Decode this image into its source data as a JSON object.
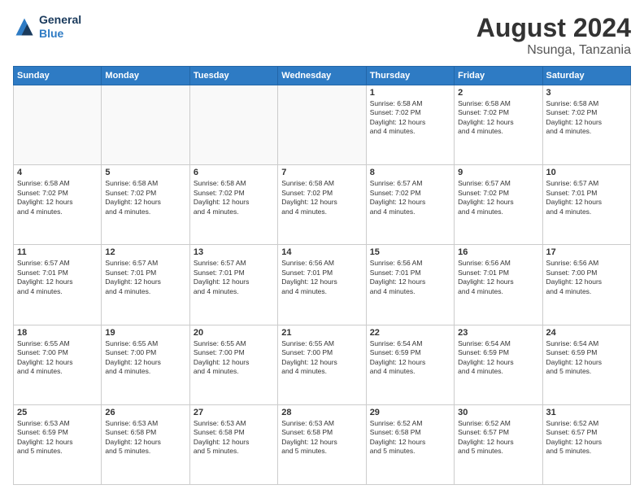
{
  "header": {
    "logo_line1": "General",
    "logo_line2": "Blue",
    "month": "August 2024",
    "location": "Nsunga, Tanzania"
  },
  "days_of_week": [
    "Sunday",
    "Monday",
    "Tuesday",
    "Wednesday",
    "Thursday",
    "Friday",
    "Saturday"
  ],
  "weeks": [
    [
      {
        "num": "",
        "info": ""
      },
      {
        "num": "",
        "info": ""
      },
      {
        "num": "",
        "info": ""
      },
      {
        "num": "",
        "info": ""
      },
      {
        "num": "1",
        "info": "Sunrise: 6:58 AM\nSunset: 7:02 PM\nDaylight: 12 hours\nand 4 minutes."
      },
      {
        "num": "2",
        "info": "Sunrise: 6:58 AM\nSunset: 7:02 PM\nDaylight: 12 hours\nand 4 minutes."
      },
      {
        "num": "3",
        "info": "Sunrise: 6:58 AM\nSunset: 7:02 PM\nDaylight: 12 hours\nand 4 minutes."
      }
    ],
    [
      {
        "num": "4",
        "info": "Sunrise: 6:58 AM\nSunset: 7:02 PM\nDaylight: 12 hours\nand 4 minutes."
      },
      {
        "num": "5",
        "info": "Sunrise: 6:58 AM\nSunset: 7:02 PM\nDaylight: 12 hours\nand 4 minutes."
      },
      {
        "num": "6",
        "info": "Sunrise: 6:58 AM\nSunset: 7:02 PM\nDaylight: 12 hours\nand 4 minutes."
      },
      {
        "num": "7",
        "info": "Sunrise: 6:58 AM\nSunset: 7:02 PM\nDaylight: 12 hours\nand 4 minutes."
      },
      {
        "num": "8",
        "info": "Sunrise: 6:57 AM\nSunset: 7:02 PM\nDaylight: 12 hours\nand 4 minutes."
      },
      {
        "num": "9",
        "info": "Sunrise: 6:57 AM\nSunset: 7:02 PM\nDaylight: 12 hours\nand 4 minutes."
      },
      {
        "num": "10",
        "info": "Sunrise: 6:57 AM\nSunset: 7:01 PM\nDaylight: 12 hours\nand 4 minutes."
      }
    ],
    [
      {
        "num": "11",
        "info": "Sunrise: 6:57 AM\nSunset: 7:01 PM\nDaylight: 12 hours\nand 4 minutes."
      },
      {
        "num": "12",
        "info": "Sunrise: 6:57 AM\nSunset: 7:01 PM\nDaylight: 12 hours\nand 4 minutes."
      },
      {
        "num": "13",
        "info": "Sunrise: 6:57 AM\nSunset: 7:01 PM\nDaylight: 12 hours\nand 4 minutes."
      },
      {
        "num": "14",
        "info": "Sunrise: 6:56 AM\nSunset: 7:01 PM\nDaylight: 12 hours\nand 4 minutes."
      },
      {
        "num": "15",
        "info": "Sunrise: 6:56 AM\nSunset: 7:01 PM\nDaylight: 12 hours\nand 4 minutes."
      },
      {
        "num": "16",
        "info": "Sunrise: 6:56 AM\nSunset: 7:01 PM\nDaylight: 12 hours\nand 4 minutes."
      },
      {
        "num": "17",
        "info": "Sunrise: 6:56 AM\nSunset: 7:00 PM\nDaylight: 12 hours\nand 4 minutes."
      }
    ],
    [
      {
        "num": "18",
        "info": "Sunrise: 6:55 AM\nSunset: 7:00 PM\nDaylight: 12 hours\nand 4 minutes."
      },
      {
        "num": "19",
        "info": "Sunrise: 6:55 AM\nSunset: 7:00 PM\nDaylight: 12 hours\nand 4 minutes."
      },
      {
        "num": "20",
        "info": "Sunrise: 6:55 AM\nSunset: 7:00 PM\nDaylight: 12 hours\nand 4 minutes."
      },
      {
        "num": "21",
        "info": "Sunrise: 6:55 AM\nSunset: 7:00 PM\nDaylight: 12 hours\nand 4 minutes."
      },
      {
        "num": "22",
        "info": "Sunrise: 6:54 AM\nSunset: 6:59 PM\nDaylight: 12 hours\nand 4 minutes."
      },
      {
        "num": "23",
        "info": "Sunrise: 6:54 AM\nSunset: 6:59 PM\nDaylight: 12 hours\nand 4 minutes."
      },
      {
        "num": "24",
        "info": "Sunrise: 6:54 AM\nSunset: 6:59 PM\nDaylight: 12 hours\nand 5 minutes."
      }
    ],
    [
      {
        "num": "25",
        "info": "Sunrise: 6:53 AM\nSunset: 6:59 PM\nDaylight: 12 hours\nand 5 minutes."
      },
      {
        "num": "26",
        "info": "Sunrise: 6:53 AM\nSunset: 6:58 PM\nDaylight: 12 hours\nand 5 minutes."
      },
      {
        "num": "27",
        "info": "Sunrise: 6:53 AM\nSunset: 6:58 PM\nDaylight: 12 hours\nand 5 minutes."
      },
      {
        "num": "28",
        "info": "Sunrise: 6:53 AM\nSunset: 6:58 PM\nDaylight: 12 hours\nand 5 minutes."
      },
      {
        "num": "29",
        "info": "Sunrise: 6:52 AM\nSunset: 6:58 PM\nDaylight: 12 hours\nand 5 minutes."
      },
      {
        "num": "30",
        "info": "Sunrise: 6:52 AM\nSunset: 6:57 PM\nDaylight: 12 hours\nand 5 minutes."
      },
      {
        "num": "31",
        "info": "Sunrise: 6:52 AM\nSunset: 6:57 PM\nDaylight: 12 hours\nand 5 minutes."
      }
    ]
  ]
}
